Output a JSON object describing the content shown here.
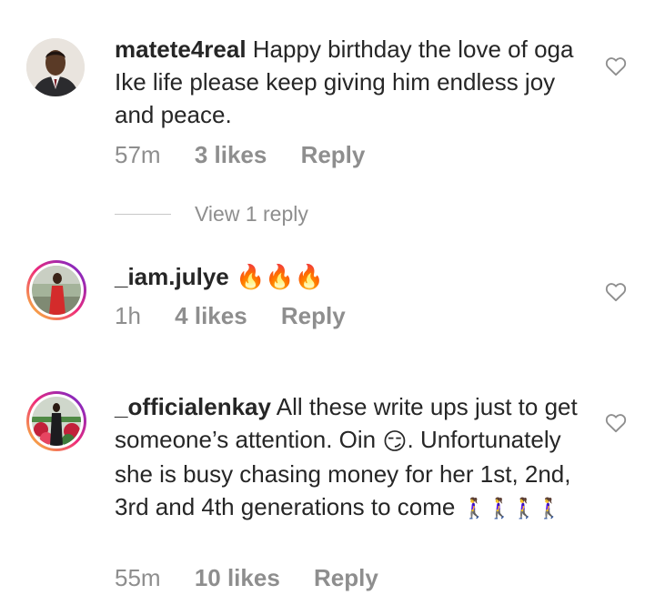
{
  "comments": [
    {
      "username": "matete4real",
      "text": "Happy birthday the love of oga Ike life please keep giving him endless joy and peace.",
      "time": "57m",
      "likes": "3 likes",
      "reply": "Reply",
      "avatar": "avatar-man-suit"
    },
    {
      "username": "_iam.julye",
      "text": "🔥🔥🔥",
      "time": "1h",
      "likes": "4 likes",
      "reply": "Reply",
      "avatar": "avatar-woman-red-dress"
    },
    {
      "username": "_officialenkay",
      "text_before": "All these write ups just to get someone’s attention. Oin",
      "text_after": ". Unfortunately she is busy chasing money for her 1st, 2nd, 3rd and 4th generations to come",
      "emoji_smirk": "😏",
      "emoji_walk": "🚶‍♀️🚶‍♀️🚶‍♀️🚶‍♀️",
      "time": "55m",
      "likes": "10 likes",
      "reply": "Reply",
      "avatar": "avatar-woman-flowers"
    }
  ],
  "view_replies": "View 1 reply",
  "colors": {
    "text": "#262626",
    "secondary": "#8e8e8e",
    "story_ring": [
      "#f9ce34",
      "#ee2a7b",
      "#6228d7"
    ]
  },
  "icons": [
    "heart-outline-icon"
  ]
}
